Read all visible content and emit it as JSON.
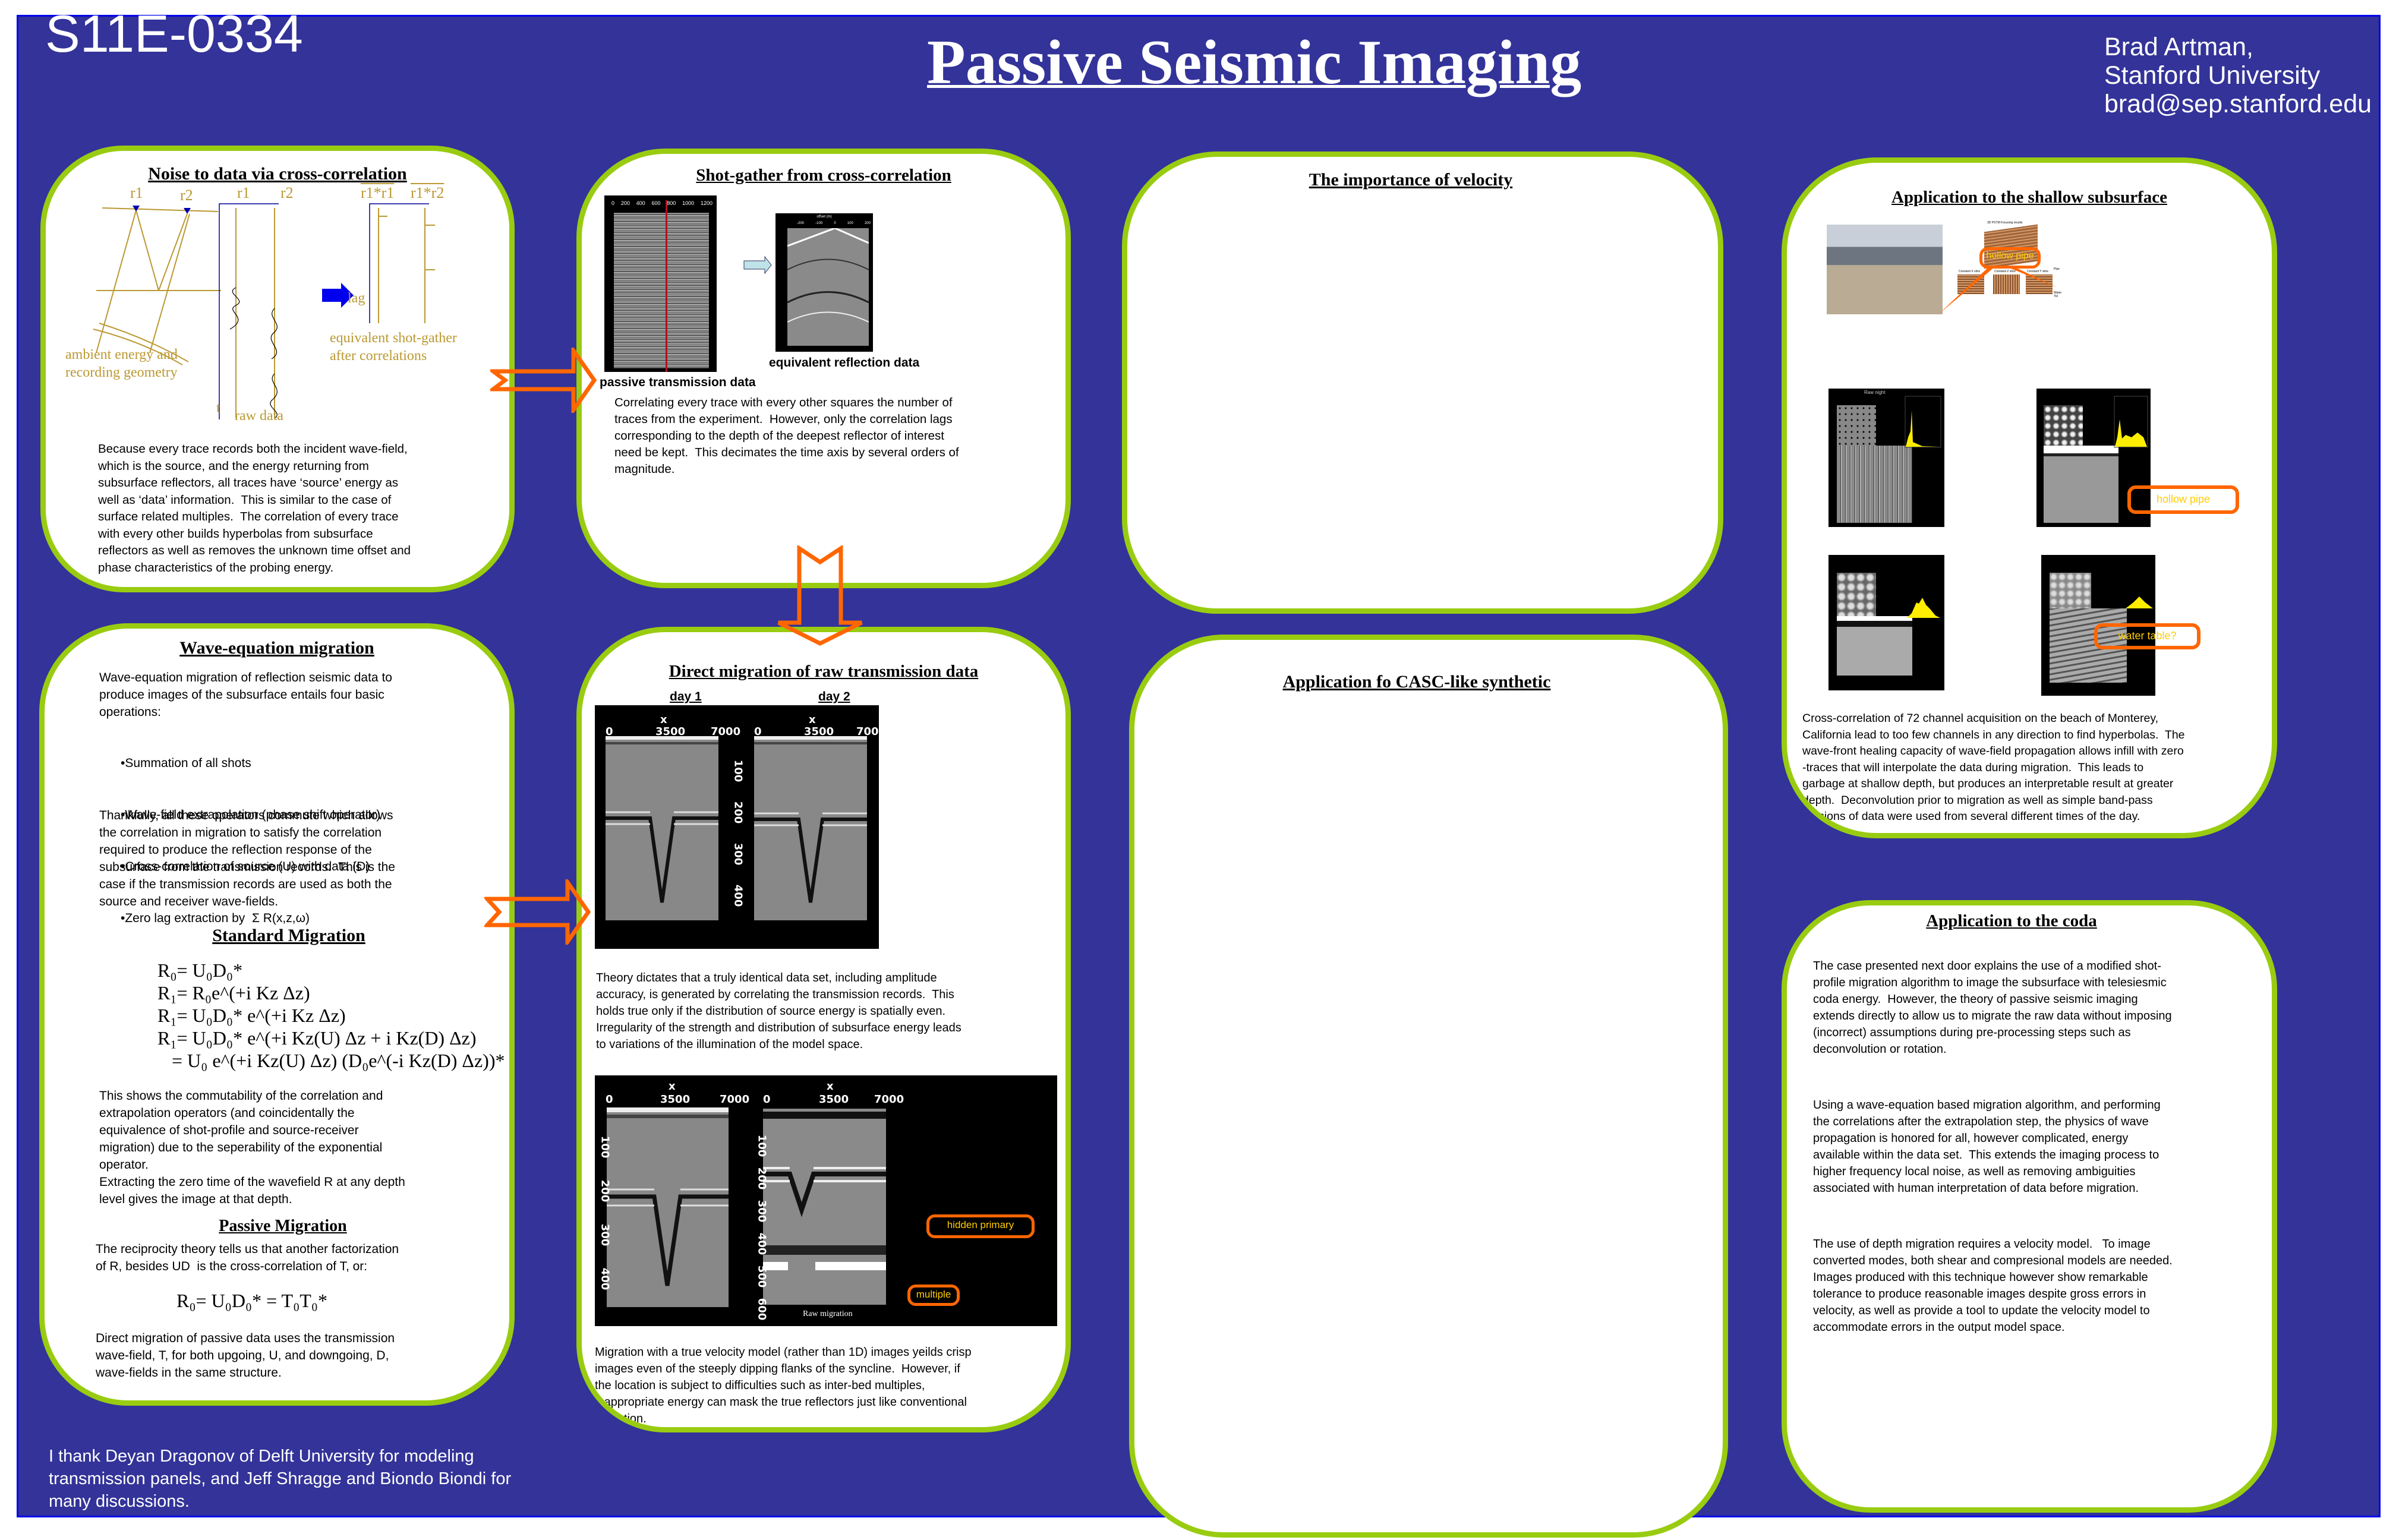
{
  "header": {
    "poster_id": "S11E-0334",
    "title": "Passive Seismic Imaging",
    "author_lines": [
      "Brad Artman,",
      "Stanford University",
      "brad@sep.stanford.edu"
    ]
  },
  "colors": {
    "background": "#333399",
    "border": "#0000ee",
    "panel_border": "#99cc11",
    "arrow": "#ff6600",
    "callout_text": "#ffcc00",
    "diagram_gold": "#bb9933"
  },
  "acknowledgement": "I thank Deyan Dragonov of Delft University for modeling transmission panels, and Jeff Shragge and Biondo Biondi for many discussions.",
  "panels": {
    "noise": {
      "title": "Noise to data via cross-correlation",
      "diagram": {
        "receiver_1": "r1",
        "receiver_2": "r2",
        "trace_labels": [
          "r1",
          "r2"
        ],
        "corr_labels": [
          "r1*r1",
          "r1*r2"
        ],
        "lag_label": "lag",
        "time_label": "t",
        "geometry_caption": "ambient energy and\nrecording geometry",
        "raw_caption": "raw data",
        "result_caption": "equivalent shot-gather\nafter correlations"
      },
      "text": "Because every trace records both the incident wave-field,\nwhich is the source, and the energy returning from\nsubsurface reflectors, all traces have ‘source’ energy as\nwell as ‘data’ information.  This is similar to the case of\nsurface related multiples.  The correlation of every trace\nwith every other builds hyperbolas from subsurface\nreflectors as well as removes the unknown time offset and\nphase characteristics of the probing energy."
    },
    "shot_gather": {
      "title": "Shot-gather from cross-correlation",
      "passive_axis_ticks": [
        "0",
        "200",
        "400",
        "600",
        "800",
        "1000",
        "1200"
      ],
      "passive_caption": "passive transmission data",
      "reflection_axis_title": "offset (m)",
      "reflection_axis_ticks": [
        "-200",
        "-100",
        "0",
        "100",
        "200"
      ],
      "reflection_caption": "equivalent reflection data",
      "text": "Correlating every trace with every other squares the number of\ntraces from the experiment.  However, only the correlation lags\ncorresponding to the depth of the deepest reflector of interest\nneed be kept.  This decimates the time axis by several orders of\nmagnitude."
    },
    "velocity": {
      "title": "The importance of velocity"
    },
    "shallow": {
      "title": "Application to the shallow subsurface",
      "cube_title": "3D PSTM Focusing results",
      "slice_titles": [
        "Constant X slice",
        "Constant Z slice",
        "Constant Y slice"
      ],
      "side_labels": [
        "Pipe",
        "Water Tbl"
      ],
      "raw_panel_title": "Raw night",
      "callouts": [
        "hollow pipe",
        "hollow pipe",
        "water table?"
      ],
      "text": "Cross-correlation of 72 channel acquisition on the beach of Monterey,\nCalifornia lead to too few channels in any direction to find hyperbolas.  The\nwave-front healing capacity of wave-field propagation allows infill with zero\n-traces that will interpolate the data during migration.  This leads to\ngarbage at shallow depth, but produces an interpretable result at greater\ndepth.  Deconvolution prior to migration as well as simple band-pass\nversions of data were used from several different times of the day."
    },
    "wave_eq": {
      "title": "Wave-equation migration",
      "intro": "Wave-equation migration of reflection seismic data to\nproduce images of the subsurface entails four basic\noperations:",
      "bullets": [
        "•Summation of all shots",
        "•Wave-field extrapolation (phase shift operator)",
        "•Cross-correlation of source (U) with data (D)",
        "•Zero lag extraction by  Σ R(x,z,ω)"
      ],
      "commute_text": "Thankfully, all these operators commute which allows\nthe correlation in migration to satisfy the correlation\nrequired to produce the reflection response of the\nsubsurface from the transmission records.  This is the\ncase if the transmission records are used as both the\nsource and receiver wave-fields.",
      "standard_title": "Standard Migration",
      "equations": [
        "R₀= U₀D₀*",
        "R₁= R₀e^(+i Kz Δz)",
        "R₁= U₀D₀* e^(+i Kz Δz)",
        "R₁= U₀D₀* e^(+i Kz(U) Δz + i Kz(D) Δz)",
        "   = U₀ e^(+i Kz(U) Δz) (D₀e^(-i Kz(D) Δz))*"
      ],
      "standard_text": "This shows the commutability of the correlation and\nextrapolation operators (and coincidentally the\nequivalence of shot-profile and source-receiver\nmigration) due to the seperability of the exponential\noperator.\nExtracting the zero time of the wavefield R at any depth\nlevel gives the image at that depth.",
      "passive_title": "Passive Migration",
      "passive_intro": "The reciprocity theory tells us that another factorization\nof R, besides UD  is the cross-correlation of T, or:",
      "passive_equation": "R₀= U₀D₀* = T₀T₀*",
      "passive_text": "Direct migration of passive data uses the transmission\nwave-field, T, for both upgoing, U, and downgoing, D,\nwave-fields in the same structure."
    },
    "direct": {
      "title": "Direct migration of raw transmission data",
      "day_labels": [
        "day 1",
        "day 2"
      ],
      "x_label": "x",
      "x_ticks": [
        "0",
        "3500",
        "7000"
      ],
      "depth_ticks_top": [
        "100",
        "200",
        "300",
        "400"
      ],
      "text1": "Theory dictates that a truly identical data set, including amplitude\naccuracy, is generated by correlating the transmission records.  This\nholds true only if the distribution of source energy is spatially even.\nIrregularity of the strength and distribution of subsurface energy leads\nto variations of the illumination of the model space.",
      "depth_ticks_left": [
        "100",
        "200",
        "300",
        "400"
      ],
      "depth_ticks_right": [
        "100",
        "200",
        "300",
        "400",
        "500",
        "600"
      ],
      "raw_migration_label": "Raw migration",
      "callouts": [
        "hidden primary",
        "multiple"
      ],
      "text2": "Migration with a true velocity model (rather than 1D) images yeilds crisp\nimages even of the steeply dipping flanks of the syncline.  However, if\nthe location is subject to difficulties such as inter-bed multiples,\ninappropriate energy can mask the true reflectors just like conventional\nreflection."
    },
    "casc": {
      "title": "Application fo CASC-like synthetic"
    },
    "coda": {
      "title": "Application to the coda",
      "paragraphs": [
        "The case presented next door explains the use of a modified shot-\nprofile migration algorithm to image the subsurface with telesiesmic\ncoda energy.  However, the theory of passive seismic imaging\nextends directly to allow us to migrate the raw data without imposing\n(incorrect) assumptions during pre-processing steps such as\ndeconvolution or rotation.",
        "Using a wave-equation based migration algorithm, and performing\nthe correlations after the extrapolation step, the physics of wave\npropagation is honored for all, however complicated, energy\navailable within the data set.  This extends the imaging process to\nhigher frequency local noise, as well as removing ambiguities\nassociated with human interpretation of data before migration.",
        "The use of depth migration requires a velocity model.   To image\nconverted modes, both shear and compresional models are needed.\nImages produced with this technique however show remarkable\ntolerance to produce reasonable images despite gross errors in\nvelocity, as well as provide a tool to update the velocity model to\naccommodate errors in the output model space."
      ]
    }
  }
}
